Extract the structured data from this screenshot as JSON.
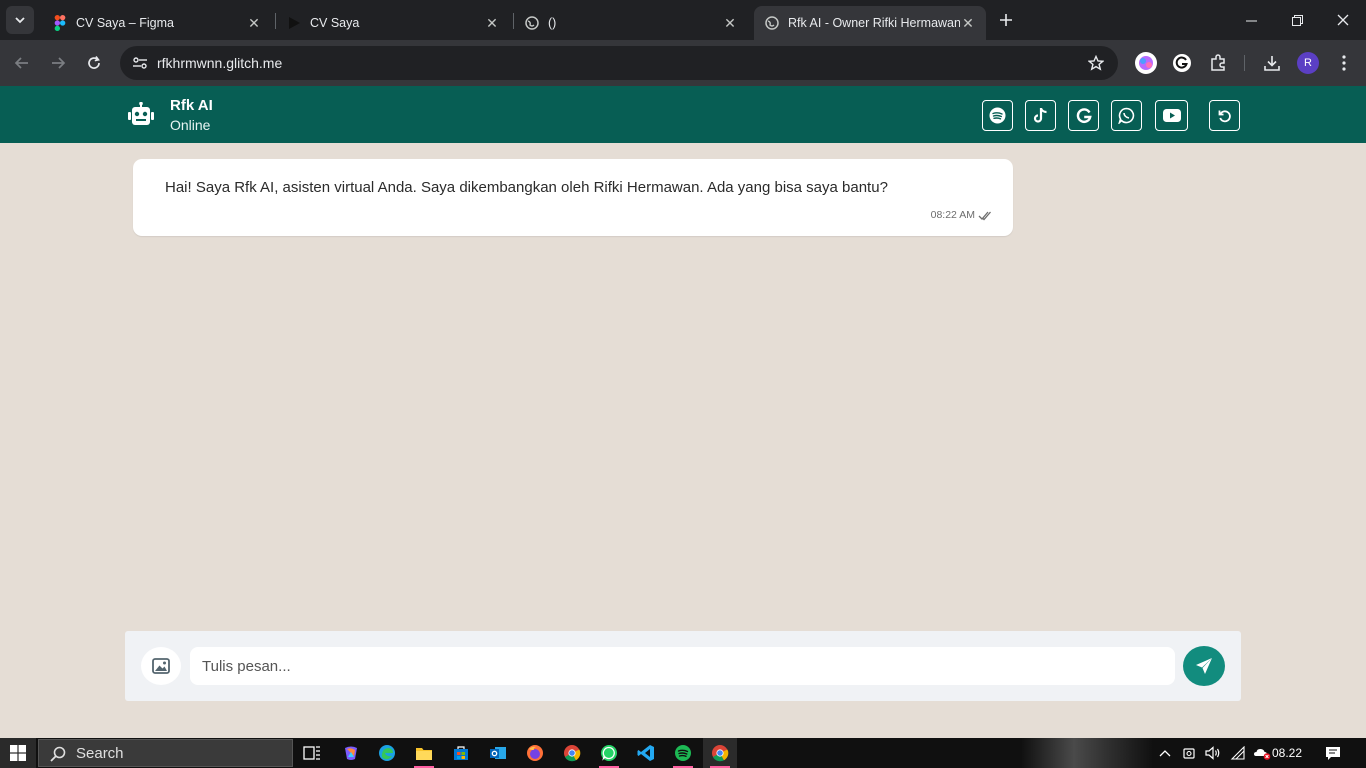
{
  "browser": {
    "tabs": [
      {
        "title": "CV Saya – Figma",
        "icon": "figma-icon"
      },
      {
        "title": "CV Saya",
        "icon": "play-icon"
      },
      {
        "title": "()",
        "icon": "globe-icon"
      },
      {
        "title": "Rfk AI - Owner Rifki Hermawan",
        "icon": "globe-icon",
        "active": true
      }
    ],
    "url": "rfkhrmwnn.glitch.me",
    "profile_initial": "R"
  },
  "header": {
    "name": "Rfk AI",
    "status": "Online",
    "buttons": [
      "spotify-icon",
      "tiktok-icon",
      "google-icon",
      "whatsapp-icon",
      "youtube-icon",
      "reset-icon"
    ],
    "color": "#075e54"
  },
  "messages": [
    {
      "text": "Hai! Saya Rfk AI, asisten virtual Anda. Saya dikembangkan oleh Rifki Hermawan. Ada yang bisa saya bantu?",
      "time": "08:22 AM",
      "status": "read"
    }
  ],
  "composer": {
    "placeholder": "Tulis pesan...",
    "send_color": "#128c7e"
  },
  "taskbar": {
    "search_label": "Search",
    "clock": "08.22"
  }
}
